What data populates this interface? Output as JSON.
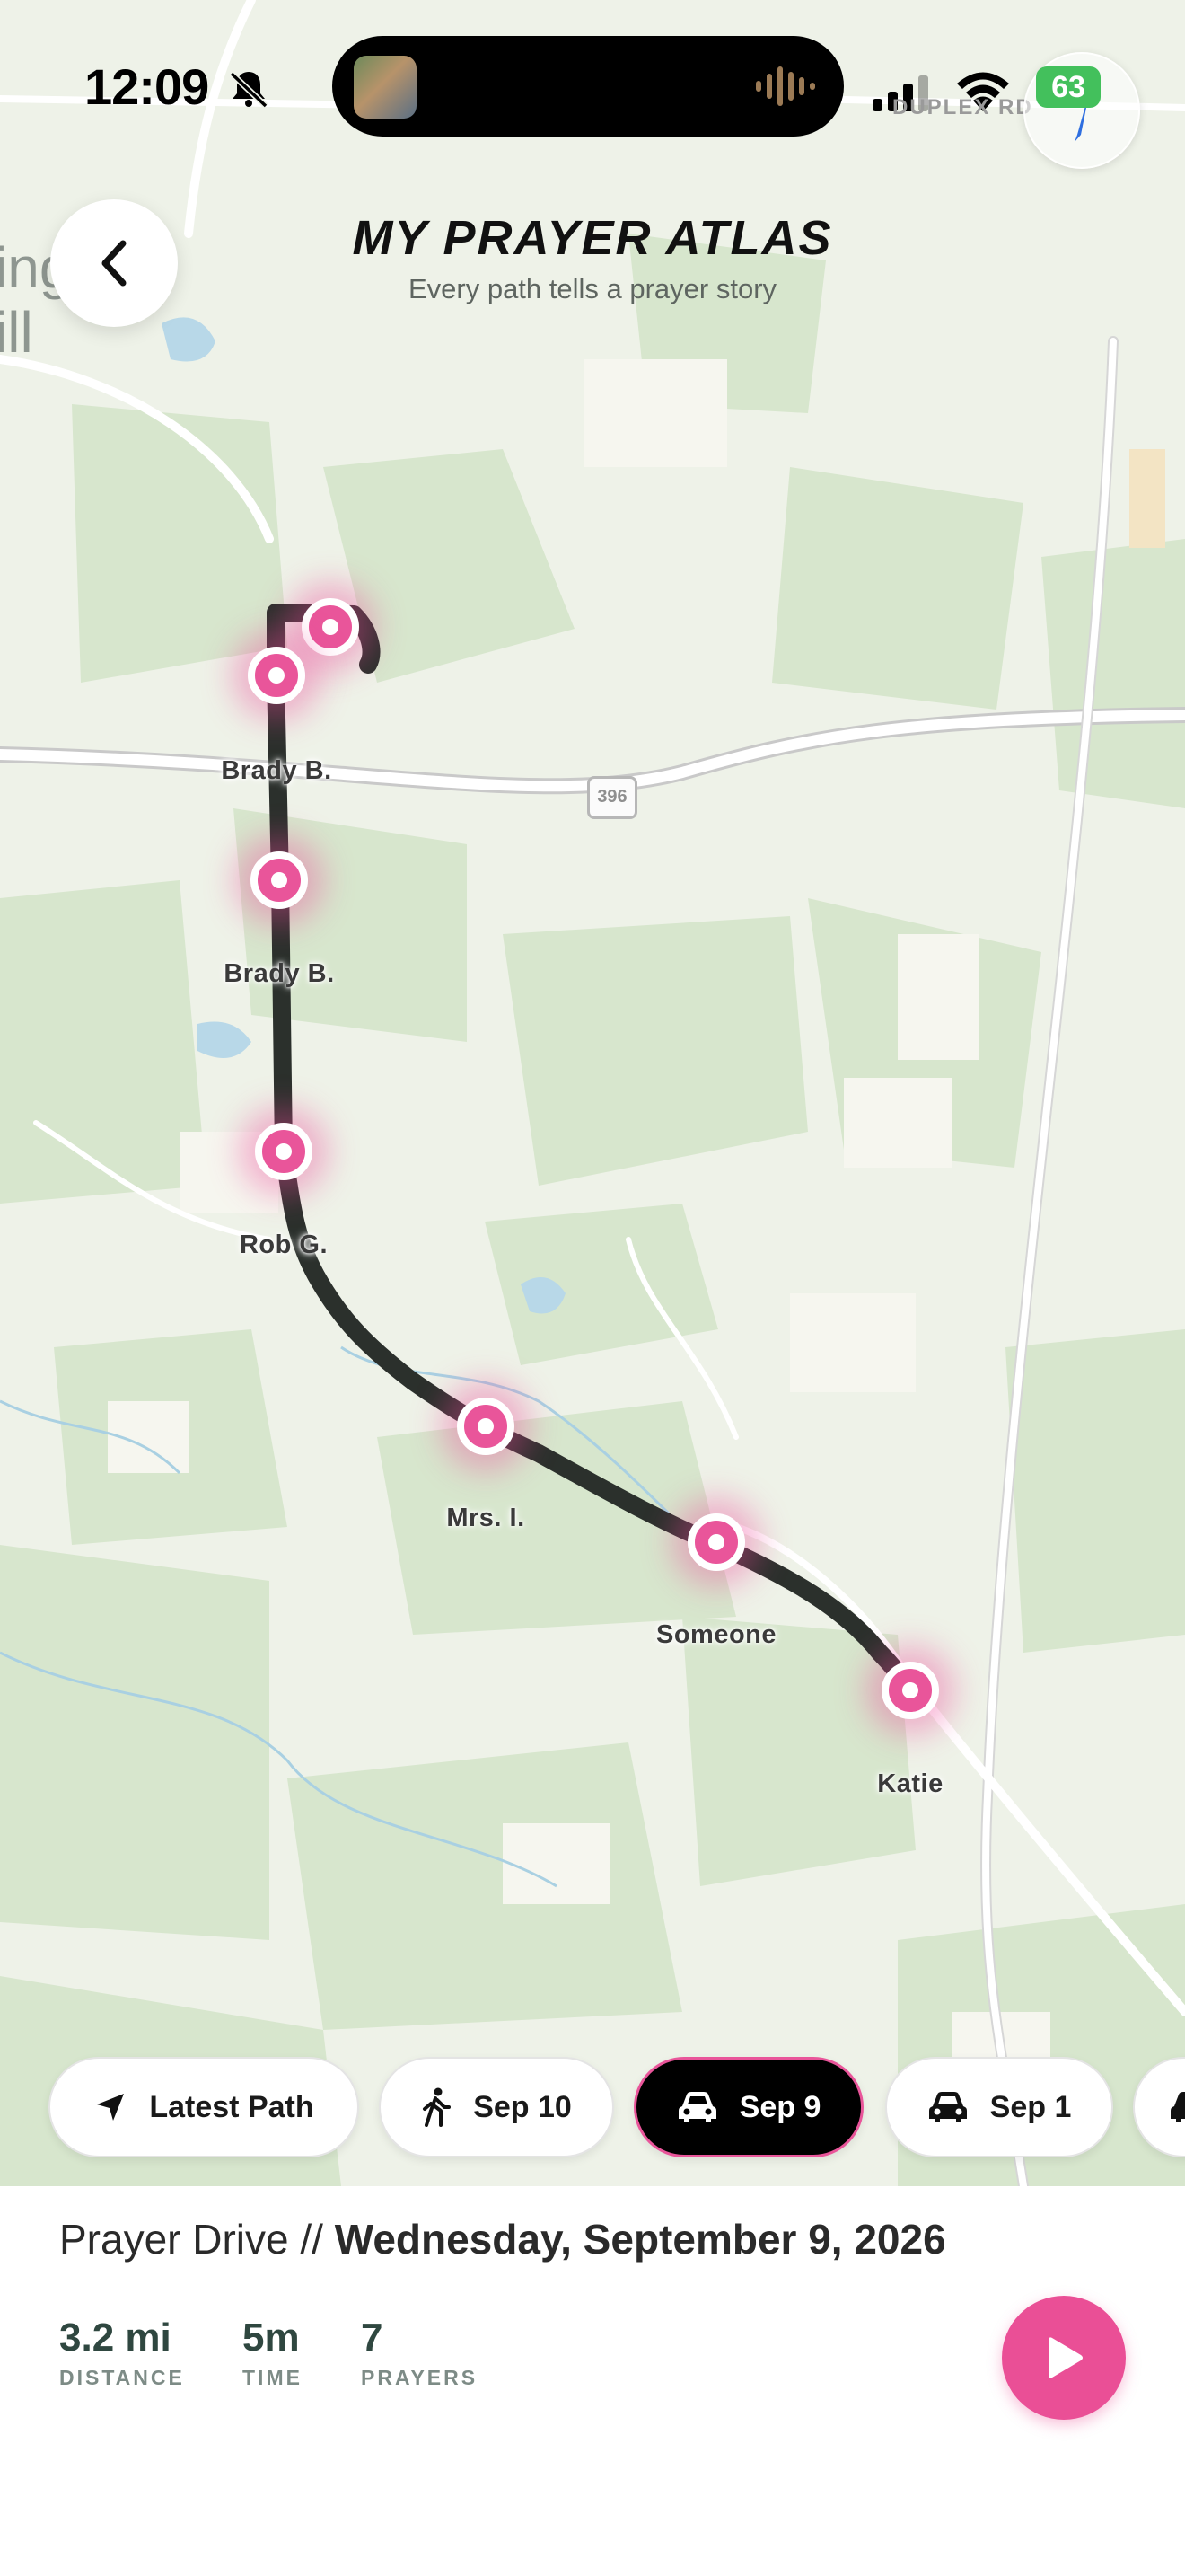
{
  "status_bar": {
    "time": "12:09",
    "battery": "63",
    "bell_icon": "bell-slash-icon",
    "signal_icon": "cellular-signal-icon",
    "wifi_icon": "wifi-icon"
  },
  "map": {
    "road_label": "DUPLEX RD",
    "route_number": "396",
    "town_fragment": "ing\nill"
  },
  "header": {
    "title": "MY PRAYER ATLAS",
    "subtitle": "Every path tells a prayer story",
    "back_icon": "chevron-left-icon",
    "compass_icon": "compass-icon"
  },
  "prayers": [
    {
      "name": "",
      "label_shown": false
    },
    {
      "name": "Brady B."
    },
    {
      "name": "Brady B."
    },
    {
      "name": "Rob G."
    },
    {
      "name": "Mrs. I."
    },
    {
      "name": "Someone"
    },
    {
      "name": "Katie"
    }
  ],
  "filters": [
    {
      "label": "Latest Path",
      "icon": "location-arrow-icon",
      "active": false
    },
    {
      "label": "Sep 10",
      "icon": "walking-icon",
      "active": false
    },
    {
      "label": "Sep 9",
      "icon": "car-icon",
      "active": true
    },
    {
      "label": "Sep 1",
      "icon": "car-icon",
      "active": false
    }
  ],
  "drive": {
    "type_label": "Prayer Drive //",
    "date": "Wednesday, September 9, 2026",
    "stats": [
      {
        "value": "3.2 mi",
        "label": "DISTANCE"
      },
      {
        "value": "5m",
        "label": "TIME"
      },
      {
        "value": "7",
        "label": "PRAYERS"
      }
    ],
    "play_icon": "play-icon"
  },
  "colors": {
    "accent": "#e9559a",
    "route": "#2b302c",
    "stat_text": "#2f4740"
  }
}
